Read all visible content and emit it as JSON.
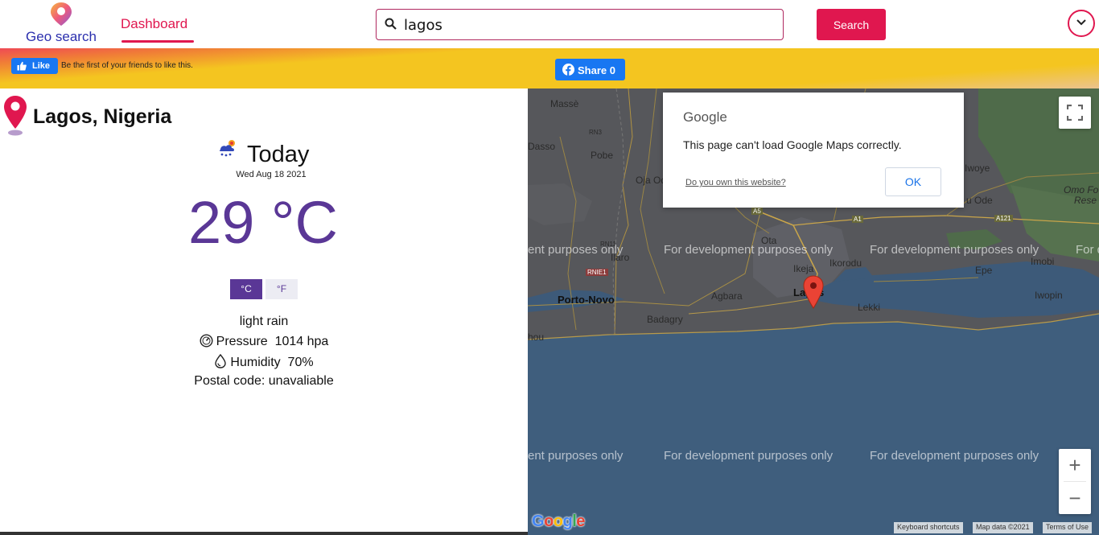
{
  "header": {
    "brand_label": "Geo search",
    "nav_dashboard": "Dashboard",
    "search_value": "lagos",
    "search_button": "Search",
    "accent_color": "#e0174f",
    "brand_color": "#2b2fae"
  },
  "social": {
    "like_label": "Like",
    "like_text": "Be the first of your friends to like this.",
    "share_label": "Share 0"
  },
  "weather": {
    "location": "Lagos, Nigeria",
    "day": "Today",
    "date": "Wed Aug 18 2021",
    "temperature": "29 °C",
    "unit_c": "°C",
    "unit_f": "°F",
    "description": "light rain",
    "pressure_label": "Pressure",
    "pressure_value": "1014 hpa",
    "humidity_label": "Humidity",
    "humidity_value": "70%",
    "postal": "Postal code: unavaliable",
    "accent_color": "#5a3796"
  },
  "map": {
    "dialog": {
      "brand": "Google",
      "message": "This page can't load Google Maps correctly.",
      "link": "Do you own this website?",
      "ok": "OK"
    },
    "watermark": "For development purposes only",
    "watermark_cut": "ent purposes only",
    "watermark_cut_right": "For d",
    "places": {
      "masse": "Massè",
      "dasso": "Dasso",
      "pobe": "Pobe",
      "ojaodan": "Oja Odan",
      "ota": "Ota",
      "ilaro": "Ilaro",
      "ifo": "Ifo",
      "ikeja": "Ikeja",
      "ikorodu": "Ikorodu",
      "portonovo": "Porto-Novo",
      "agbara": "Agbara",
      "badagry": "Badagry",
      "lagos": "Lagos",
      "lekki": "Lekki",
      "epe": "Epe",
      "iwopin": "Iwopin",
      "imobi": "Imobi",
      "ode": "u Ode",
      "iwoye": "Iwoye",
      "omoforest": "Omo Fo",
      "reserve": "Rese",
      "hou": "hou",
      "rn3": "RN3",
      "rn11": "RN11",
      "rnie1": "RNIE1",
      "a1": "A1",
      "a1b": "A1",
      "a121": "A121",
      "a5": "A5"
    },
    "zoom_in": "+",
    "zoom_out": "−",
    "logo": "Google",
    "attrib_keyboard": "Keyboard shortcuts",
    "attrib_data": "Map data ©2021",
    "attrib_terms": "Terms of Use"
  }
}
